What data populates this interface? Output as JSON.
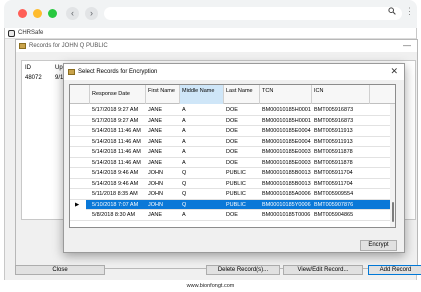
{
  "browser": {
    "back_icon": "back-arrow-icon",
    "forward_icon": "forward-arrow-icon",
    "search_icon": "search-icon",
    "menu_icon": "vertical-dots-icon"
  },
  "app": {
    "title": "CHRSafe"
  },
  "records_window": {
    "title": "Records for JOHN Q PUBLIC",
    "columns": [
      "ID",
      "Uploa"
    ],
    "first_row": {
      "id": "48072",
      "date": "9/13/"
    }
  },
  "dialog": {
    "title": "Select Records for Encryption",
    "close_symbol": "✕",
    "columns": [
      "Response Date",
      "First Name",
      "Middle Name",
      "Last Name",
      "TCN",
      "ICN"
    ],
    "rows": [
      [
        "5/17/2018 9:27 AM",
        "JANE",
        "A",
        "DOE",
        "BM00010185H0001",
        "BMT005916873"
      ],
      [
        "5/17/2018 9:27 AM",
        "JANE",
        "A",
        "DOE",
        "BM00010185H0001",
        "BMT005916873"
      ],
      [
        "5/14/2018 11:46 AM",
        "JANE",
        "A",
        "DOE",
        "BM00010185E0004",
        "BMT005911913"
      ],
      [
        "5/14/2018 11:46 AM",
        "JANE",
        "A",
        "DOE",
        "BM00010185E0004",
        "BMT005911913"
      ],
      [
        "5/14/2018 11:46 AM",
        "JANE",
        "A",
        "DOE",
        "BM00010185E0003",
        "BMT005911878"
      ],
      [
        "5/14/2018 11:46 AM",
        "JANE",
        "A",
        "DOE",
        "BM00010185E0003",
        "BMT005911878"
      ],
      [
        "5/14/2018 9:46 AM",
        "JOHN",
        "Q",
        "PUBLIC",
        "BM00010185B0013",
        "BMT005911704"
      ],
      [
        "5/14/2018 9:46 AM",
        "JOHN",
        "Q",
        "PUBLIC",
        "BM00010185B0013",
        "BMT005911704"
      ],
      [
        "5/11/2018 8:35 AM",
        "JOHN",
        "Q",
        "PUBLIC",
        "BM00010185A0006",
        "BMT005909554"
      ],
      [
        "5/10/2018 7:07 AM",
        "JOHN",
        "Q",
        "PUBLIC",
        "BM00010185Y0006",
        "BMT005907876"
      ],
      [
        "5/8/2018 8:30 AM",
        "JANE",
        "A",
        "DOE",
        "BM00010185T0006",
        "BMT005904865"
      ]
    ],
    "selected_row_index": 9,
    "row_pointer": "▶",
    "encrypt_label": "Encrypt"
  },
  "footer_buttons": {
    "close": "Close",
    "delete": "Delete Record(s)...",
    "view_edit": "View/Edit Record...",
    "add": "Add Record"
  },
  "watermark": "www.bionfongt.com",
  "colors": {
    "selection": "#0a78d8",
    "header_highlight": "#cfe6f8"
  }
}
